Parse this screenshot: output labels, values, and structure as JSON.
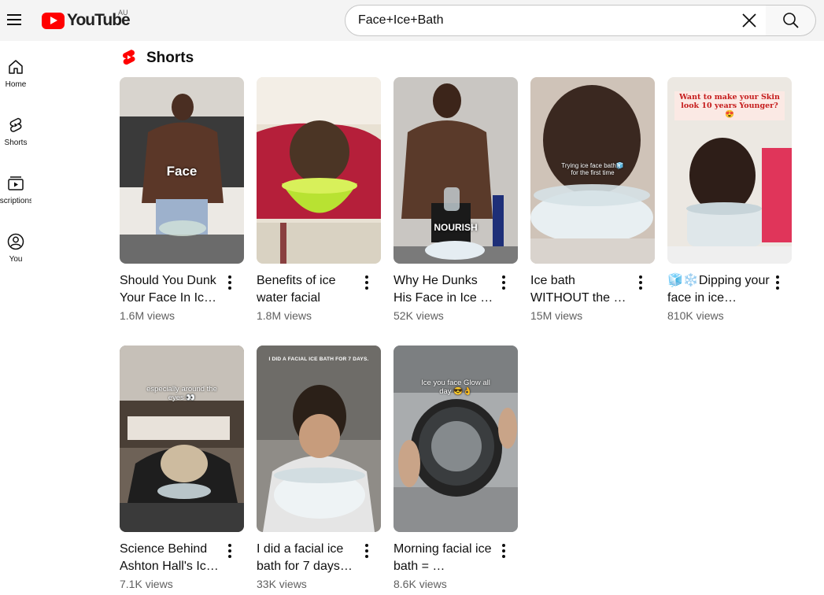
{
  "header": {
    "logo_text": "YouTube",
    "region": "AU",
    "search_value": "Face+Ice+Bath"
  },
  "sidebar": {
    "items": [
      {
        "label": "Home",
        "icon": "home-icon"
      },
      {
        "label": "Shorts",
        "icon": "shorts-icon"
      },
      {
        "label": "Subscriptions",
        "icon": "subscriptions-icon"
      },
      {
        "label": "You",
        "icon": "you-icon"
      }
    ]
  },
  "shorts": {
    "title": "Shorts",
    "items": [
      {
        "title": "Should You Dunk Your Face In Ic…",
        "views": "1.6M views",
        "overlay": "Face"
      },
      {
        "title": "Benefits of ice water facial",
        "views": "1.8M views",
        "overlay": ""
      },
      {
        "title": "Why He Dunks His Face in Ice …",
        "views": "52K views",
        "overlay": "NOURISH"
      },
      {
        "title": "Ice bath WITHOUT the …",
        "views": "15M views",
        "overlay": "Trying ice face bath🧊 for the first time"
      },
      {
        "title": "🧊❄️Dipping your face in ice…",
        "views": "810K views",
        "overlay": "Want to make your Skin look 10 years Younger?😍"
      },
      {
        "title": "Science Behind Ashton Hall's Ic…",
        "views": "7.1K views",
        "overlay": "especially around the eyes 👀"
      },
      {
        "title": "I did a facial ice bath for 7 days…",
        "views": "33K views",
        "overlay": "I DID A FACIAL ICE BATH FOR 7 DAYS."
      },
      {
        "title": "Morning facial ice bath = …",
        "views": "8.6K views",
        "overlay": "Ice you face Glow all day 😎👌"
      }
    ]
  },
  "colors": {
    "accent": "#ff0000",
    "secondary_text": "#606060"
  }
}
